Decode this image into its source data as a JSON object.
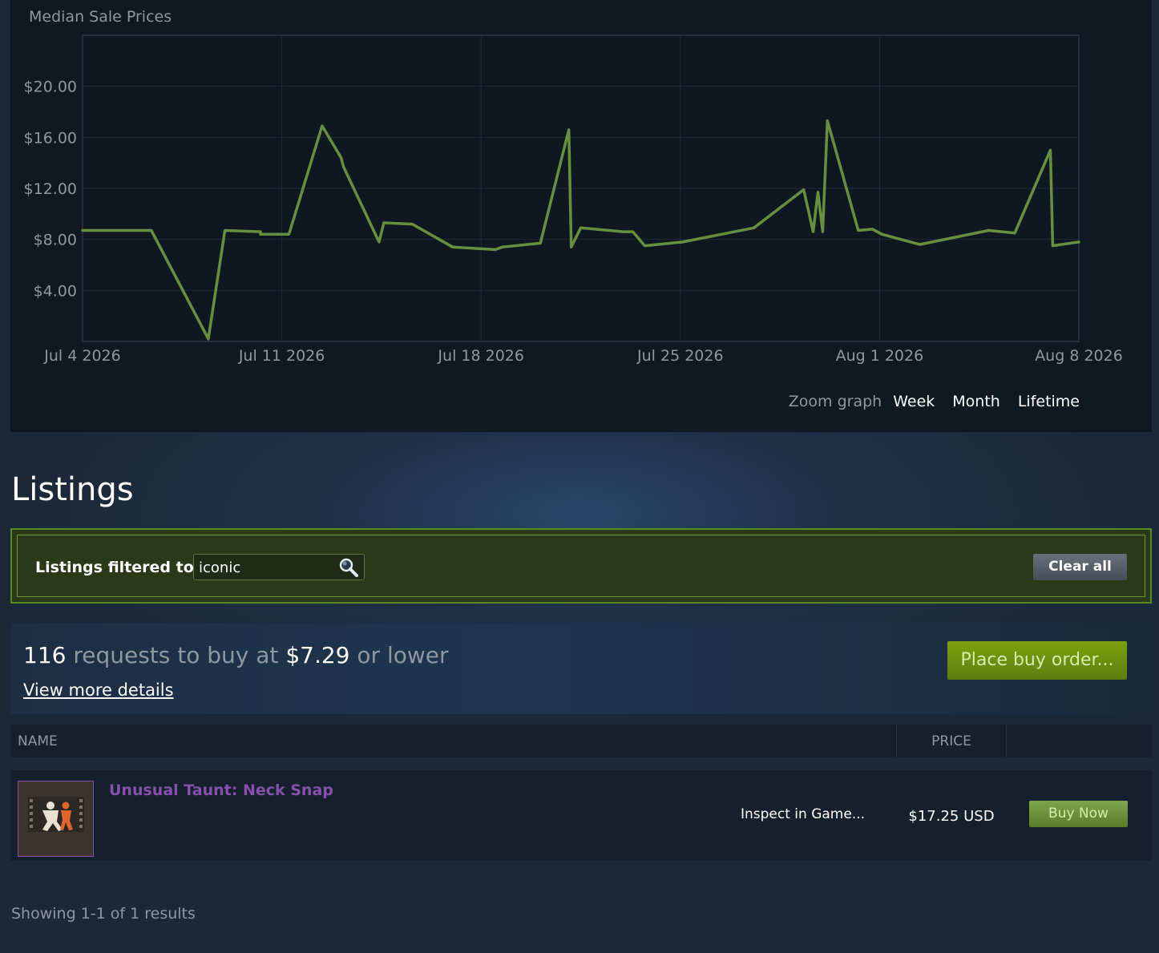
{
  "chart_data": {
    "type": "line",
    "title": "Median Sale Prices",
    "y_tick_labels": [
      "$20.00",
      "$16.00",
      "$12.00",
      "$8.00",
      "$4.00"
    ],
    "y_ticks": [
      20,
      16,
      12,
      8,
      4
    ],
    "x_tick_labels": [
      "Jul 4 2026",
      "Jul 11 2026",
      "Jul 18 2026",
      "Jul 25 2026",
      "Aug 1 2026",
      "Aug 8 2026"
    ],
    "x_ticks": [
      "2026-07-04",
      "2026-07-11",
      "2026-07-18",
      "2026-07-25",
      "2026-08-01",
      "2026-08-08"
    ],
    "xlim": [
      "2026-07-04",
      "2026-08-08"
    ],
    "ylim": [
      0,
      24
    ],
    "grid": true,
    "line_color": "#688f3e",
    "series": [
      {
        "x": [
          "2026-07-04",
          "2026-07-06 10:00",
          "2026-07-08 10:00",
          "2026-07-09 00:00",
          "2026-07-10 06:00",
          "2026-07-10 06:00",
          "2026-07-11 06:00",
          "2026-07-12 10:00",
          "2026-07-13 02:00",
          "2026-07-13 04:00",
          "2026-07-14 10:00",
          "2026-07-14 14:00",
          "2026-07-15 14:00",
          "2026-07-17 00:00",
          "2026-07-18 12:00",
          "2026-07-18 18:00",
          "2026-07-20 02:00",
          "2026-07-21 02:00",
          "2026-07-21 04:00",
          "2026-07-21 12:00",
          "2026-07-23 00:00",
          "2026-07-23 08:00",
          "2026-07-23 18:00",
          "2026-07-25 02:00",
          "2026-07-27 14:00",
          "2026-07-29 08:00",
          "2026-07-29 16:00",
          "2026-07-29 20:00",
          "2026-07-30 00:00",
          "2026-07-30 04:00",
          "2026-07-31 06:00",
          "2026-07-31 18:00",
          "2026-08-01 02:00",
          "2026-08-02 10:00",
          "2026-08-04 20:00",
          "2026-08-05 18:00",
          "2026-08-07 00:00",
          "2026-08-07 02:00",
          "2026-08-08 00:00"
        ],
        "values": [
          8.7,
          8.7,
          0.2,
          8.7,
          8.6,
          8.4,
          8.4,
          16.9,
          14.4,
          13.7,
          7.8,
          9.3,
          9.2,
          7.4,
          7.2,
          7.4,
          7.7,
          16.6,
          7.4,
          8.9,
          8.6,
          8.6,
          7.5,
          7.8,
          8.9,
          11.9,
          8.6,
          11.7,
          8.6,
          17.3,
          8.7,
          8.8,
          8.4,
          7.6,
          8.7,
          8.5,
          15.0,
          7.5,
          7.8
        ]
      }
    ]
  },
  "zoom": {
    "label": "Zoom graph",
    "options": [
      "Week",
      "Month",
      "Lifetime"
    ]
  },
  "listings": {
    "title": "Listings",
    "filter_label": "Listings filtered to:",
    "filter_value": "iconic",
    "clear_all_label": "Clear all"
  },
  "buy_orders": {
    "count": "116",
    "text_mid": " requests to buy at ",
    "price": "$7.29",
    "text_end": " or lower",
    "view_details_label": "View more details",
    "place_order_label": "Place buy order..."
  },
  "table": {
    "headers": {
      "name": "NAME",
      "price": "PRICE"
    },
    "rows": [
      {
        "name": "Unusual Taunt: Neck Snap",
        "name_color": "#8650ac",
        "inspect_label": "Inspect in Game...",
        "price": "$17.25 USD",
        "buy_label": "Buy Now"
      }
    ]
  },
  "footer": {
    "showing": "Showing 1-1 of 1 results"
  }
}
